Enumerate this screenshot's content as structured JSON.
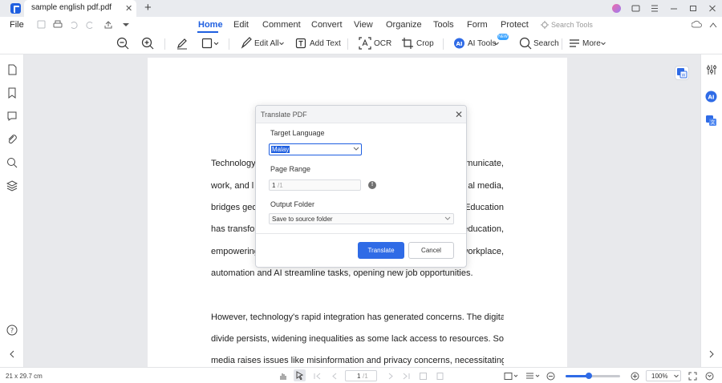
{
  "titlebar": {
    "tab_label": "sample english pdf.pdf",
    "close_glyph": "✕",
    "new_tab_glyph": "+"
  },
  "menubar": {
    "file_label": "File",
    "tabs": [
      "Home",
      "Edit",
      "Comment",
      "Convert",
      "View",
      "Organize",
      "Tools",
      "Form",
      "Protect"
    ],
    "active_tab": "Home",
    "search_placeholder": "Search Tools"
  },
  "toolbar": {
    "edit_all": "Edit All",
    "add_text": "Add Text",
    "ocr": "OCR",
    "crop": "Crop",
    "ai_tools": "AI Tools",
    "search": "Search",
    "more": "More",
    "ai_badge": "NEW"
  },
  "document": {
    "lines": [
      "Technology'",
      "work, and l",
      "bridges geo",
      "has transfo",
      "empowering",
      "automation and AI streamline tasks, opening new job opportunities.",
      "However, technology's rapid integration has generated concerns. The digital",
      "divide persists, widening inequalities as some lack access to resources. Social",
      "media raises issues like misinformation and privacy concerns, necessitating"
    ],
    "right_fragments": [
      "municate,",
      "al media,",
      "Education",
      "education,",
      "workplace,"
    ]
  },
  "dialog": {
    "title": "Translate PDF",
    "close_glyph": "✕",
    "target_language_label": "Target Language",
    "target_language_value": "Malay",
    "page_range_label": "Page Range",
    "page_range_value": "1",
    "page_range_total": "/1",
    "info_glyph": "!",
    "output_folder_label": "Output Folder",
    "output_folder_value": "Save to source folder",
    "translate_button": "Translate",
    "cancel_button": "Cancel"
  },
  "statusbar": {
    "page_size": "21 x 29.7 cm",
    "current_page": "1",
    "total_pages": "/1",
    "zoom": "100%",
    "zoom_fraction": 0.42
  },
  "colors": {
    "accent": "#1f5fe0",
    "button": "#2f6be6"
  }
}
